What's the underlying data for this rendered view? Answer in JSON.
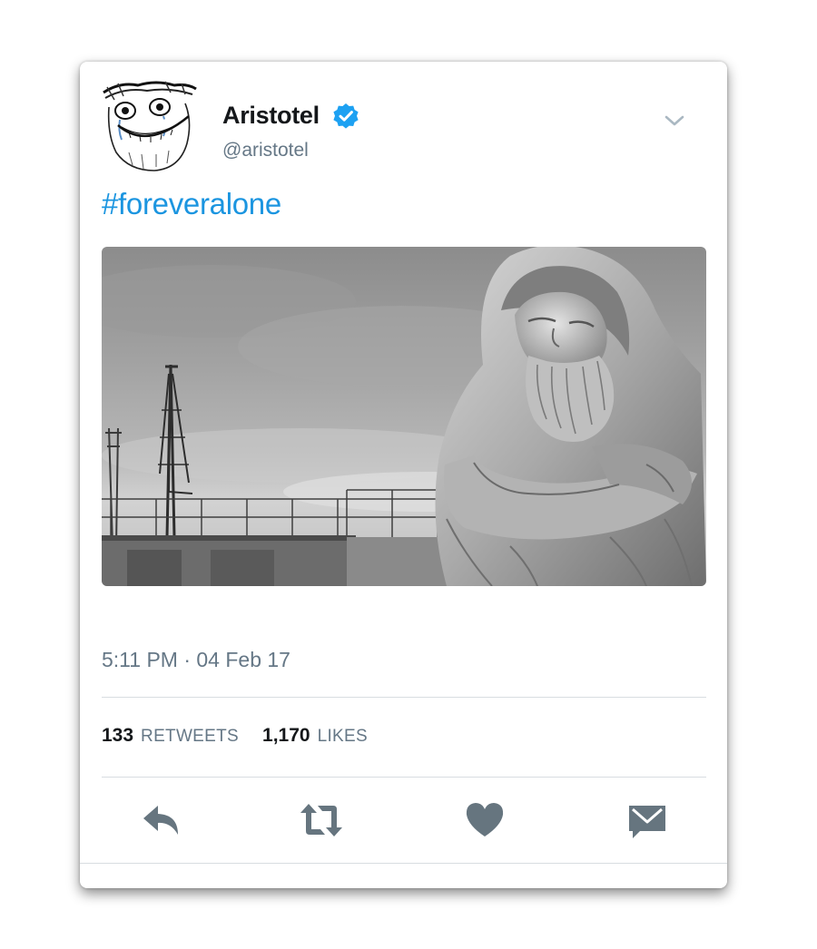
{
  "tweet": {
    "user": {
      "name": "Aristotel",
      "handle": "@aristotel",
      "verified": true,
      "avatar_icon": "forever-alone-meme-face"
    },
    "text": "#foreveralone",
    "media_description": "grayscale-statue-of-bearded-man-in-hood-beside-harbor-crane",
    "timestamp": "5:11 PM · 04 Feb 17",
    "stats": {
      "retweets_count": "133",
      "retweets_label": "RETWEETS",
      "likes_count": "1,170",
      "likes_label": "LIKES"
    },
    "actions": [
      {
        "icon": "reply-icon"
      },
      {
        "icon": "retweet-icon"
      },
      {
        "icon": "heart-icon"
      },
      {
        "icon": "direct-message-icon"
      }
    ]
  },
  "colors": {
    "link": "#1b95e0",
    "text_primary": "#14171a",
    "text_secondary": "#657786",
    "verified_badge": "#1da1f2",
    "action_icon": "#66757f",
    "divider": "#d8dde1"
  }
}
